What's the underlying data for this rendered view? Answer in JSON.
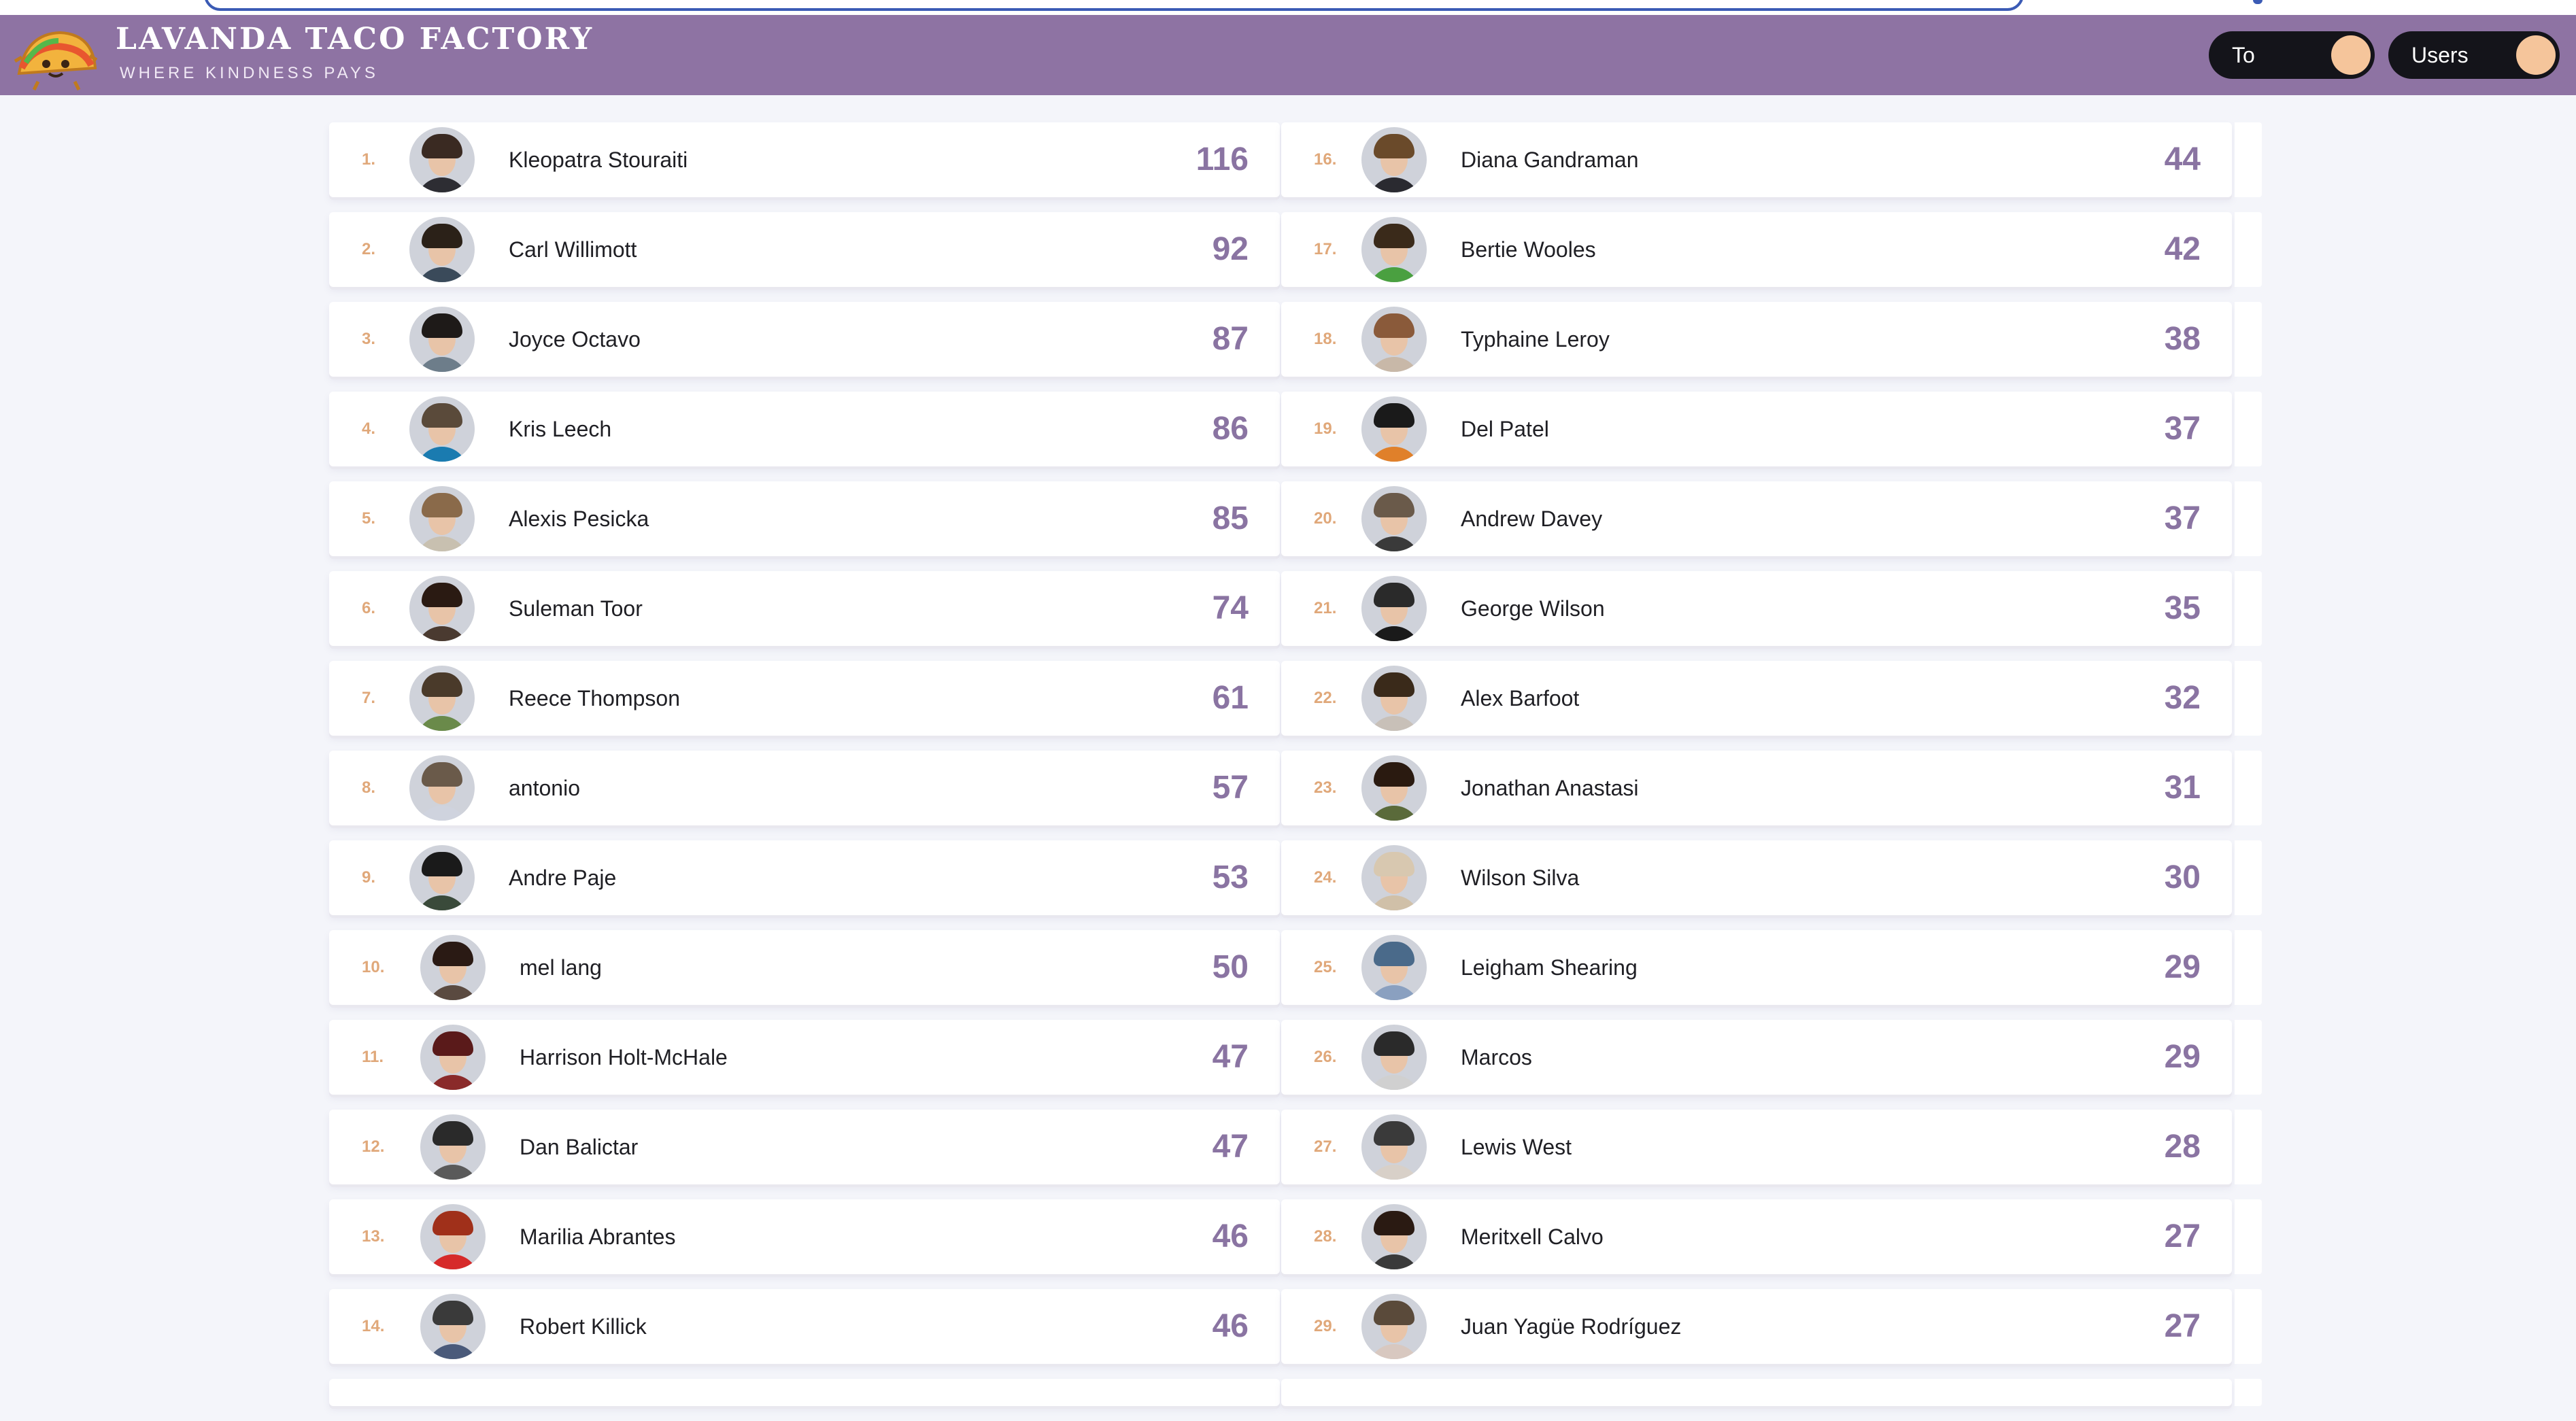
{
  "app": {
    "title": "LAVANDA TACO FACTORY",
    "subtitle": "WHERE KINDNESS PAYS"
  },
  "toggles": {
    "to_label": "To",
    "users_label": "Users"
  },
  "colors": {
    "header": "#8e73a3",
    "score": "#8a74a2",
    "rank": "#e0a87a",
    "toggle_bg": "#14141a",
    "toggle_knob": "#f5c59b"
  },
  "leaderboard": {
    "left": [
      {
        "rank": "1.",
        "name": "Kleopatra Stouraiti",
        "score": "116"
      },
      {
        "rank": "2.",
        "name": "Carl Willimott",
        "score": "92"
      },
      {
        "rank": "3.",
        "name": "Joyce Octavo",
        "score": "87"
      },
      {
        "rank": "4.",
        "name": "Kris Leech",
        "score": "86"
      },
      {
        "rank": "5.",
        "name": "Alexis Pesicka",
        "score": "85"
      },
      {
        "rank": "6.",
        "name": "Suleman Toor",
        "score": "74"
      },
      {
        "rank": "7.",
        "name": "Reece Thompson",
        "score": "61"
      },
      {
        "rank": "8.",
        "name": "antonio",
        "score": "57"
      },
      {
        "rank": "9.",
        "name": "Andre Paje",
        "score": "53"
      },
      {
        "rank": "10.",
        "name": "mel lang",
        "score": "50"
      },
      {
        "rank": "11.",
        "name": "Harrison Holt-McHale",
        "score": "47"
      },
      {
        "rank": "12.",
        "name": "Dan Balictar",
        "score": "47"
      },
      {
        "rank": "13.",
        "name": "Marilia Abrantes",
        "score": "46"
      },
      {
        "rank": "14.",
        "name": "Robert Killick",
        "score": "46"
      }
    ],
    "right": [
      {
        "rank": "16.",
        "name": "Diana Gandraman",
        "score": "44"
      },
      {
        "rank": "17.",
        "name": "Bertie Wooles",
        "score": "42"
      },
      {
        "rank": "18.",
        "name": "Typhaine Leroy",
        "score": "38"
      },
      {
        "rank": "19.",
        "name": "Del Patel",
        "score": "37"
      },
      {
        "rank": "20.",
        "name": "Andrew Davey",
        "score": "37"
      },
      {
        "rank": "21.",
        "name": "George Wilson",
        "score": "35"
      },
      {
        "rank": "22.",
        "name": "Alex Barfoot",
        "score": "32"
      },
      {
        "rank": "23.",
        "name": "Jonathan Anastasi",
        "score": "31"
      },
      {
        "rank": "24.",
        "name": "Wilson Silva",
        "score": "30"
      },
      {
        "rank": "25.",
        "name": "Leigham Shearing",
        "score": "29"
      },
      {
        "rank": "26.",
        "name": "Marcos",
        "score": "29"
      },
      {
        "rank": "27.",
        "name": "Lewis West",
        "score": "28"
      },
      {
        "rank": "28.",
        "name": "Meritxell Calvo",
        "score": "27"
      },
      {
        "rank": "29.",
        "name": "Juan Yagüe Rodríguez",
        "score": "27"
      }
    ]
  }
}
